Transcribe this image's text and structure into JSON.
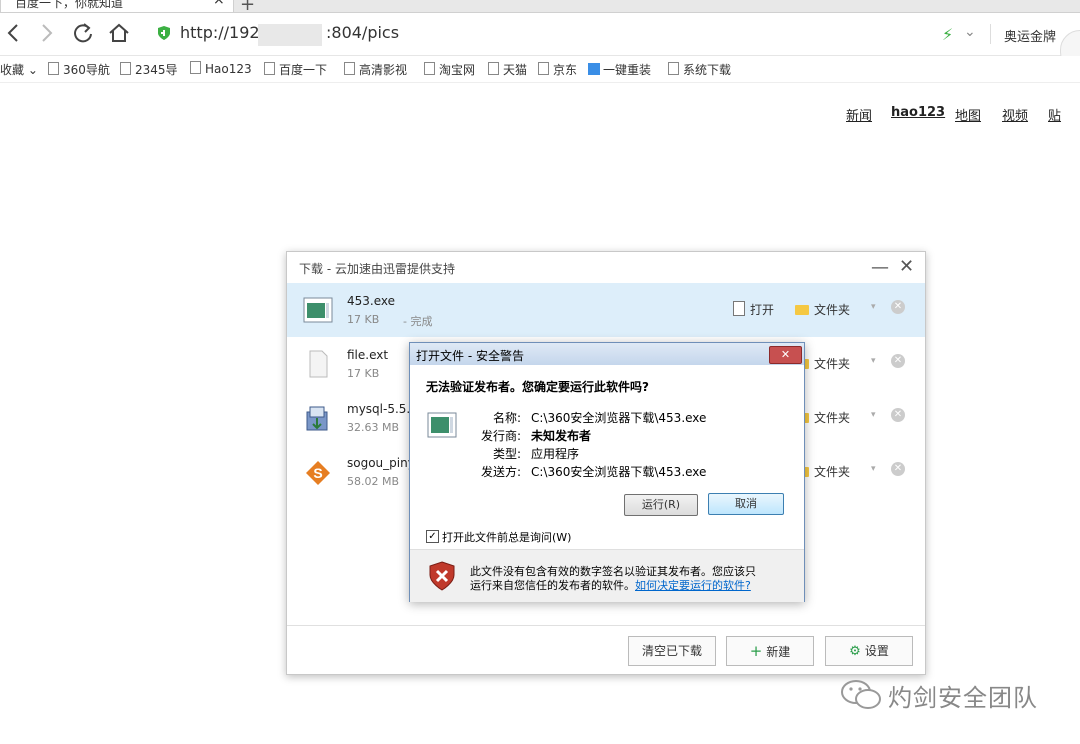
{
  "tab": {
    "title": "百度一下，你就知道",
    "close": "×",
    "new_tab": "+"
  },
  "address": {
    "url_prefix": "http://192.",
    "url_suffix": ":804/pics",
    "ad_text": "奥运金牌"
  },
  "bookmarks": {
    "fav_label": "收藏",
    "items": [
      "360导航",
      "2345导",
      "Hao123",
      "百度一下",
      "高清影视",
      "淘宝网",
      "天猫",
      "京东",
      "一键重装",
      "系统下载"
    ]
  },
  "toplinks": [
    "新闻",
    "hao123",
    "地图",
    "视频",
    "贴"
  ],
  "download": {
    "title": "下载 - 云加速由迅雷提供支持",
    "minimize": "—",
    "close": "✕",
    "items": [
      {
        "name": "453.exe",
        "size": "17 KB",
        "status": "- 完成",
        "open": "打开",
        "folder": "文件夹"
      },
      {
        "name": "file.ext",
        "size": "17 KB",
        "status": "",
        "folder": "文件夹"
      },
      {
        "name": "mysql-5.5.2",
        "size": "32.63 MB",
        "status": "",
        "folder": "文件夹"
      },
      {
        "name": "sogou_piny",
        "size": "58.02 MB",
        "status": "",
        "folder": "文件夹"
      }
    ],
    "footer": {
      "clear": "清空已下载",
      "new": "新建",
      "settings": "设置"
    }
  },
  "warning": {
    "title": "打开文件 - 安全警告",
    "close": "✕",
    "question": "无法验证发布者。您确定要运行此软件吗?",
    "fields": [
      {
        "label": "名称:",
        "value": "C:\\360安全浏览器下载\\453.exe"
      },
      {
        "label": "发行商:",
        "value": "未知发布者"
      },
      {
        "label": "类型:",
        "value": "应用程序"
      },
      {
        "label": "发送方:",
        "value": "C:\\360安全浏览器下载\\453.exe"
      }
    ],
    "run": "运行(R)",
    "cancel": "取消",
    "checkbox_label": "打开此文件前总是询问(W)",
    "checkbox_checked": "✓",
    "info_line1": "此文件没有包含有效的数字签名以验证其发布者。您应该只",
    "info_line2": "运行来自您信任的发布者的软件。",
    "info_link": "如何决定要运行的软件?"
  },
  "watermark": "灼剑安全团队"
}
